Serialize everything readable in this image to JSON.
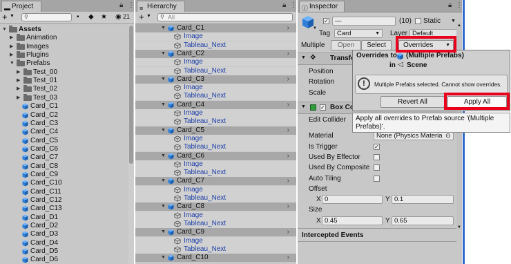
{
  "project": {
    "tab": "Project",
    "search_placeholder": "",
    "hidden_count": "21",
    "items": [
      {
        "label": "Assets",
        "type": "folder",
        "level": 0,
        "expanded": true
      },
      {
        "label": "Animation",
        "type": "folder",
        "level": 1,
        "expanded": false
      },
      {
        "label": "Images",
        "type": "folder",
        "level": 1,
        "expanded": false
      },
      {
        "label": "Plugins",
        "type": "folder",
        "level": 1,
        "expanded": false
      },
      {
        "label": "Prefabs",
        "type": "folder",
        "level": 1,
        "expanded": true
      },
      {
        "label": "Test_00",
        "type": "folder",
        "level": 2,
        "expanded": false
      },
      {
        "label": "Test_01",
        "type": "folder",
        "level": 2,
        "expanded": false
      },
      {
        "label": "Test_02",
        "type": "folder",
        "level": 2,
        "expanded": false
      },
      {
        "label": "Test_03",
        "type": "folder",
        "level": 2,
        "expanded": false
      },
      {
        "label": "Card_C1",
        "type": "prefab",
        "level": 2
      },
      {
        "label": "Card_C2",
        "type": "prefab",
        "level": 2
      },
      {
        "label": "Card_C3",
        "type": "prefab",
        "level": 2
      },
      {
        "label": "Card_C4",
        "type": "prefab",
        "level": 2
      },
      {
        "label": "Card_C5",
        "type": "prefab",
        "level": 2
      },
      {
        "label": "Card_C6",
        "type": "prefab",
        "level": 2
      },
      {
        "label": "Card_C7",
        "type": "prefab",
        "level": 2
      },
      {
        "label": "Card_C8",
        "type": "prefab",
        "level": 2
      },
      {
        "label": "Card_C9",
        "type": "prefab",
        "level": 2
      },
      {
        "label": "Card_C10",
        "type": "prefab",
        "level": 2
      },
      {
        "label": "Card_C11",
        "type": "prefab",
        "level": 2
      },
      {
        "label": "Card_C12",
        "type": "prefab",
        "level": 2
      },
      {
        "label": "Card_C13",
        "type": "prefab",
        "level": 2
      },
      {
        "label": "Card_D1",
        "type": "prefab",
        "level": 2
      },
      {
        "label": "Card_D2",
        "type": "prefab",
        "level": 2
      },
      {
        "label": "Card_D3",
        "type": "prefab",
        "level": 2
      },
      {
        "label": "Card_D4",
        "type": "prefab",
        "level": 2
      },
      {
        "label": "Card_D5",
        "type": "prefab",
        "level": 2
      },
      {
        "label": "Card_D6",
        "type": "prefab",
        "level": 2
      }
    ]
  },
  "hierarchy": {
    "tab": "Hierarchy",
    "search_placeholder": "All",
    "items": [
      {
        "label": "Card_C1",
        "type": "prefab"
      },
      {
        "label": "Image",
        "type": "child"
      },
      {
        "label": "Tableau_Next",
        "type": "child"
      },
      {
        "label": "Card_C2",
        "type": "prefab"
      },
      {
        "label": "Image",
        "type": "child"
      },
      {
        "label": "Tableau_Next",
        "type": "child"
      },
      {
        "label": "Card_C3",
        "type": "prefab"
      },
      {
        "label": "Image",
        "type": "child"
      },
      {
        "label": "Tableau_Next",
        "type": "child"
      },
      {
        "label": "Card_C4",
        "type": "prefab"
      },
      {
        "label": "Image",
        "type": "child"
      },
      {
        "label": "Tableau_Next",
        "type": "child"
      },
      {
        "label": "Card_C5",
        "type": "prefab"
      },
      {
        "label": "Image",
        "type": "child"
      },
      {
        "label": "Tableau_Next",
        "type": "child"
      },
      {
        "label": "Card_C6",
        "type": "prefab"
      },
      {
        "label": "Image",
        "type": "child"
      },
      {
        "label": "Tableau_Next",
        "type": "child"
      },
      {
        "label": "Card_C7",
        "type": "prefab"
      },
      {
        "label": "Image",
        "type": "child"
      },
      {
        "label": "Tableau_Next",
        "type": "child"
      },
      {
        "label": "Card_C8",
        "type": "prefab"
      },
      {
        "label": "Image",
        "type": "child"
      },
      {
        "label": "Tableau_Next",
        "type": "child"
      },
      {
        "label": "Card_C9",
        "type": "prefab"
      },
      {
        "label": "Image",
        "type": "child"
      },
      {
        "label": "Tableau_Next",
        "type": "child"
      },
      {
        "label": "Card_C10",
        "type": "prefab"
      }
    ]
  },
  "inspector": {
    "tab": "Inspector",
    "name_value": "—",
    "count": "(10)",
    "static_label": "Static",
    "tag_label": "Tag",
    "tag_value": "Card",
    "layer_label": "Layer",
    "layer_value": "Default",
    "multiple_label": "Multiple",
    "open_label": "Open",
    "select_label": "Select",
    "overrides_label": "Overrides",
    "transform_title": "Transfo",
    "position_label": "Position",
    "rotation_label": "Rotation",
    "scale_label": "Scale",
    "box_title": "Box Co",
    "edit_collider_label": "Edit Collider",
    "material_label": "Material",
    "material_value": "None (Physics Materia",
    "is_trigger_label": "Is Trigger",
    "used_by_effector_label": "Used By Effector",
    "used_by_composite_label": "Used By Composite",
    "auto_tiling_label": "Auto Tiling",
    "offset_label": "Offset",
    "offset_x_label": "X",
    "offset_x": "0",
    "offset_y_label": "Y",
    "offset_y": "0.1",
    "size_label": "Size",
    "size_x_label": "X",
    "size_x": "0.45",
    "size_y_label": "Y",
    "size_y": "0.65",
    "intercepted_label": "Intercepted Events"
  },
  "overrides_popup": {
    "title_prefix": "Overrides to",
    "title_target": "(Multiple Prefabs)",
    "in_label": "in",
    "scene_label": "Scene",
    "message": "Multiple Prefabs selected. Cannot show overrides.",
    "revert_all": "Revert All",
    "apply_all": "Apply All",
    "tooltip": "Apply all overrides to Prefab source '(Multiple Prefabs)'."
  },
  "colors": {
    "highlight_red": "#e8001c",
    "prefab_blue": "#1c3ea8",
    "cube_blue": "#2f7fd9"
  }
}
